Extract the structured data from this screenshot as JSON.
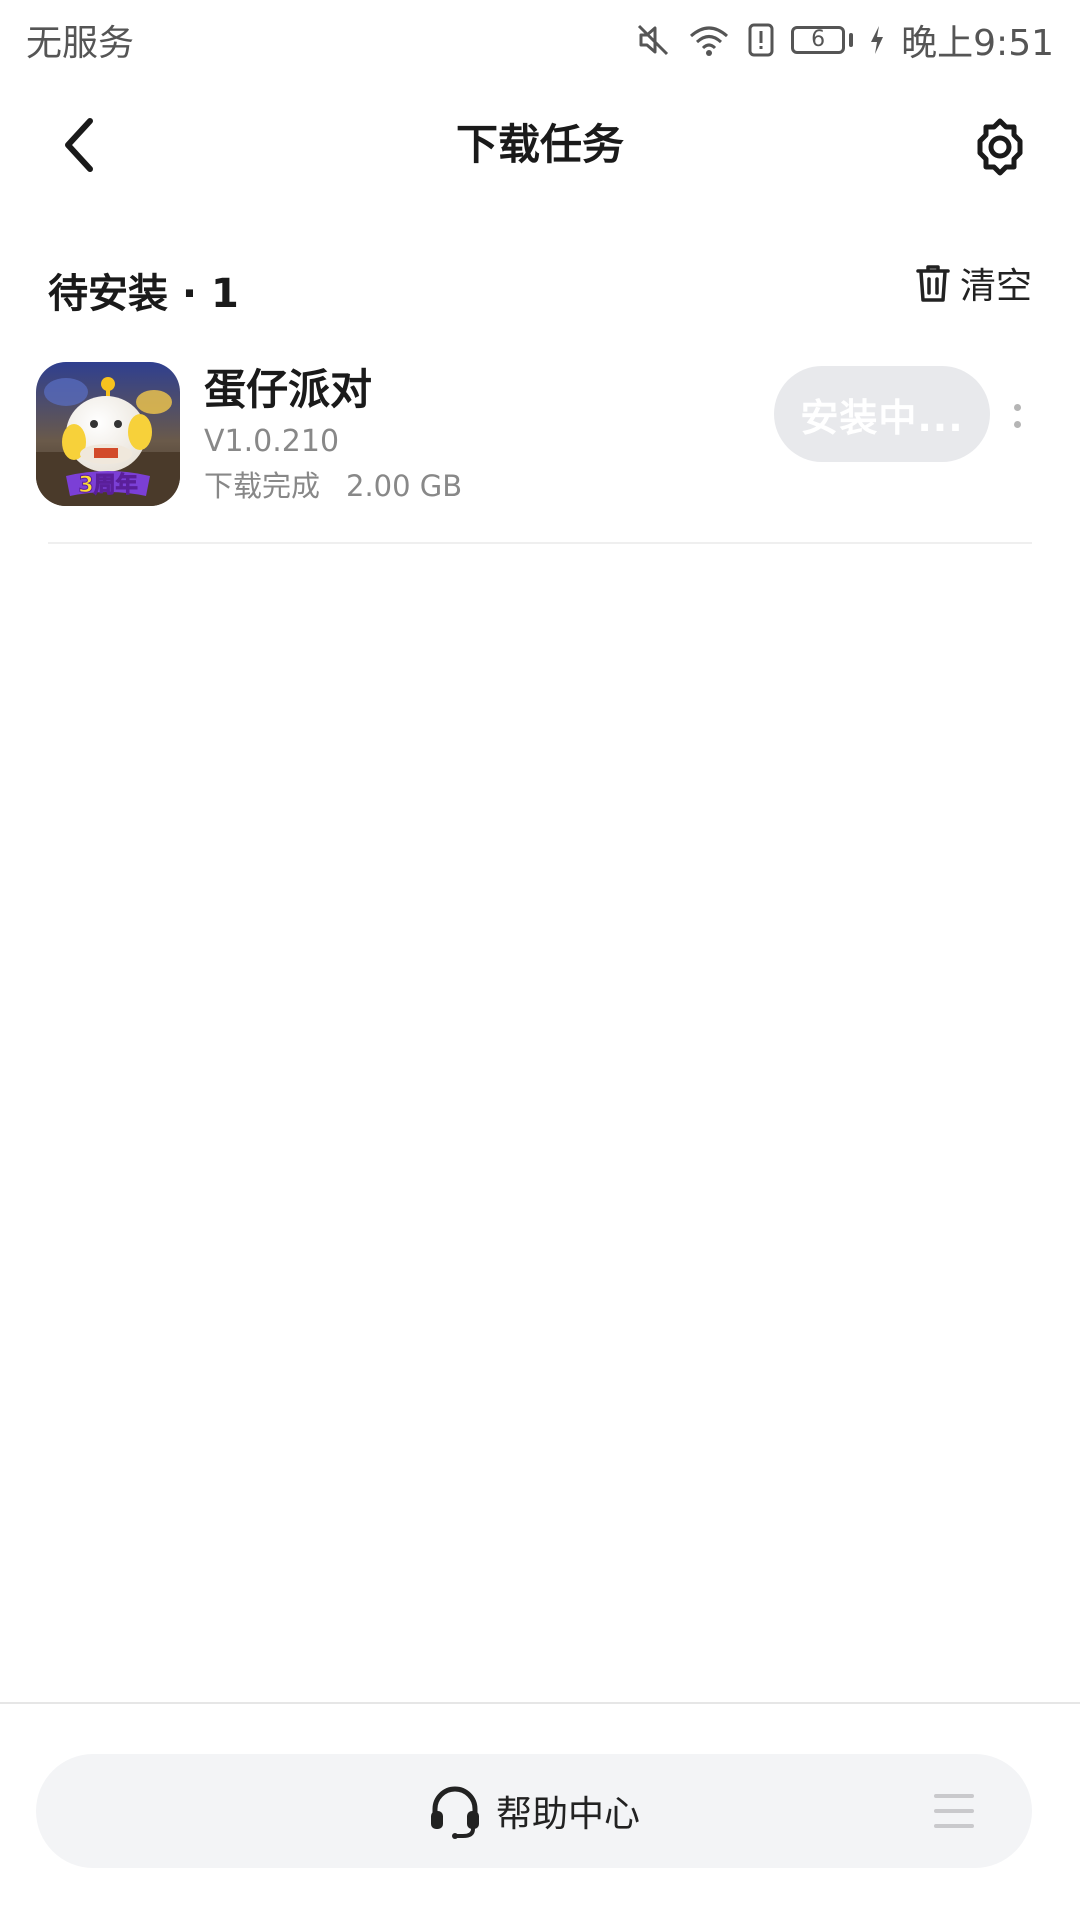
{
  "status_bar": {
    "carrier": "无服务",
    "battery_level": "6",
    "time": "晚上9:51",
    "icons": [
      "mute-icon",
      "wifi-icon",
      "alert-icon",
      "battery-icon",
      "charging-icon"
    ]
  },
  "header": {
    "title": "下载任务",
    "back_icon": "back-arrow-icon",
    "settings_icon": "gear-icon"
  },
  "section": {
    "title": "待安装 · 1",
    "clear_label": "清空",
    "clear_icon": "trash-icon"
  },
  "apps": [
    {
      "name": "蛋仔派对",
      "version": "V1.0.210",
      "status": "下载完成",
      "size": "2.00 GB",
      "button_label": "安装中...",
      "icon_badge": "3周年",
      "icon": "app-icon"
    }
  ],
  "bottom": {
    "help_label": "帮助中心",
    "help_icon": "headset-icon",
    "menu_icon": "menu-icon"
  },
  "colors": {
    "install_button_bg": "#e8e9ec",
    "bottom_bar_bg": "#f3f4f6",
    "secondary_text": "#888888"
  }
}
